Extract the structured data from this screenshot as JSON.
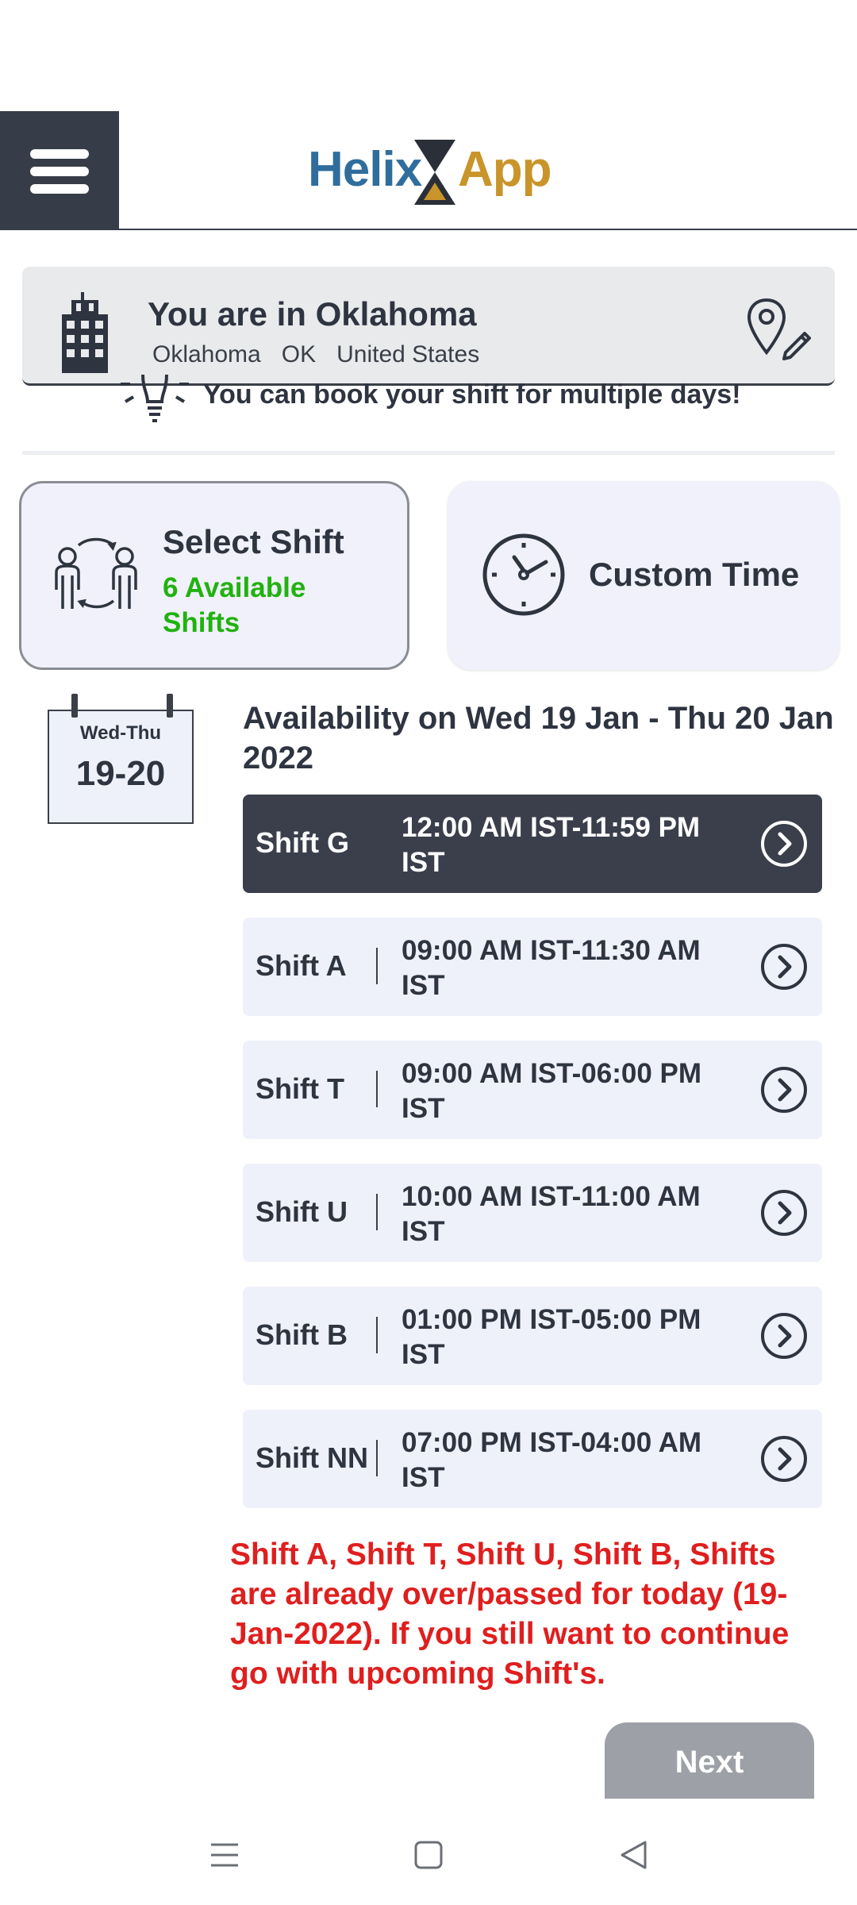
{
  "header": {
    "logo_left": "Helix",
    "logo_right": "App"
  },
  "location": {
    "title": "You are in Oklahoma",
    "city": "Oklahoma",
    "state": "OK",
    "country": "United States"
  },
  "tip": "You can book your shift for multiple days!",
  "options": {
    "select_shift": {
      "title": "Select Shift",
      "available": "6 Available Shifts"
    },
    "custom_time": {
      "title": "Custom Time"
    }
  },
  "calendar": {
    "days": "Wed-Thu",
    "dates": "19-20"
  },
  "availability_title": "Availability on Wed 19 Jan - Thu 20 Jan 2022",
  "shifts": [
    {
      "name": "Shift G",
      "time": "12:00 AM IST-11:59 PM IST",
      "selected": true
    },
    {
      "name": "Shift A",
      "time": "09:00 AM IST-11:30 AM IST",
      "selected": false
    },
    {
      "name": "Shift T",
      "time": "09:00 AM IST-06:00 PM IST",
      "selected": false
    },
    {
      "name": "Shift U",
      "time": "10:00 AM IST-11:00 AM IST",
      "selected": false
    },
    {
      "name": "Shift B",
      "time": "01:00 PM IST-05:00 PM IST",
      "selected": false
    },
    {
      "name": "Shift NN",
      "time": "07:00 PM IST-04:00 AM IST",
      "selected": false
    }
  ],
  "warning": "Shift A, Shift T, Shift U, Shift B, Shifts are already over/passed for today (19-Jan-2022). If you still want to continue go with upcoming Shift's.",
  "next_label": "Next",
  "colors": {
    "header_dark": "#373d48",
    "accent_green": "#21b20f",
    "warning_red": "#e01e1e",
    "logo_blue": "#2f6e9c",
    "logo_gold": "#c9942a"
  },
  "icons": {
    "menu": "hamburger-icon",
    "building": "building-icon",
    "location_edit": "location-pin-edit-icon",
    "tip": "lightbulb-icon",
    "shift": "people-exchange-icon",
    "custom": "clock-icon",
    "row_arrow": "chevron-right-circle-icon"
  }
}
